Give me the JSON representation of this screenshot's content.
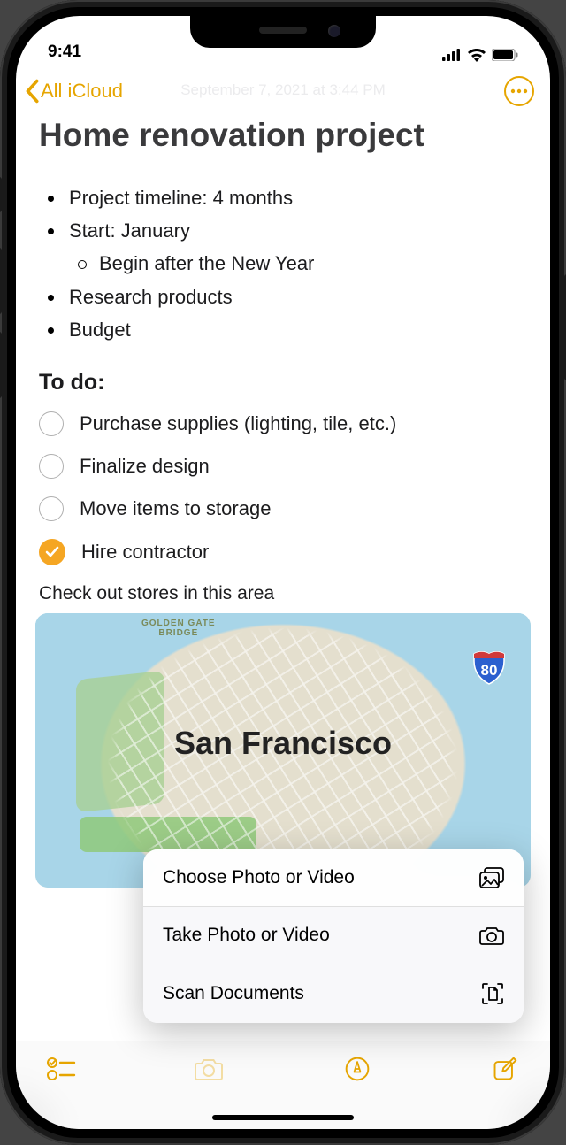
{
  "status": {
    "time": "9:41"
  },
  "nav": {
    "back_label": "All iCloud"
  },
  "faint_date": "September 7, 2021 at 3:44 PM",
  "note": {
    "title": "Home renovation project",
    "bullets": [
      "Project timeline: 4 months",
      "Start: January",
      "Research products",
      "Budget"
    ],
    "sub_bullet": "Begin after the New Year",
    "todo_heading": "To do:",
    "todos": [
      {
        "label": "Purchase supplies (lighting, tile, etc.)",
        "done": false
      },
      {
        "label": "Finalize design",
        "done": false
      },
      {
        "label": "Move items to storage",
        "done": false
      },
      {
        "label": "Hire contractor",
        "done": true
      }
    ],
    "map_caption": "Check out stores in this area",
    "map": {
      "city": "San Francisco",
      "bridge": "GOLDEN GATE\nBRIDGE",
      "highway": "80"
    }
  },
  "popup": {
    "items": [
      {
        "label": "Choose Photo or Video",
        "icon": "photo"
      },
      {
        "label": "Take Photo or Video",
        "icon": "camera"
      },
      {
        "label": "Scan Documents",
        "icon": "scan"
      }
    ]
  },
  "faint_bg_text": "San Francisco"
}
